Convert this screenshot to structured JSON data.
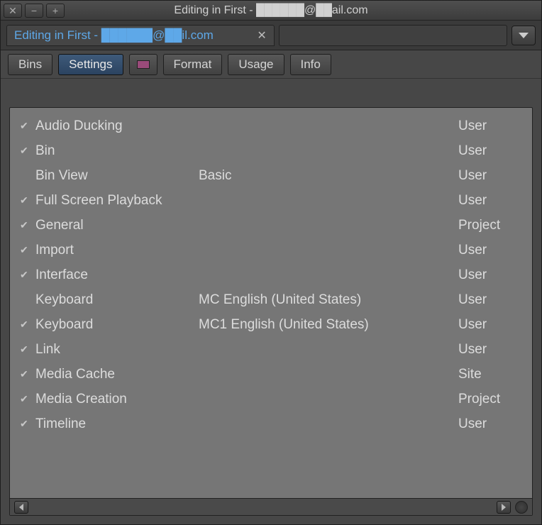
{
  "window": {
    "title": "Editing in First - ██████@██ail.com"
  },
  "doc_tab": {
    "label": "Editing in First - ██████@██il.com"
  },
  "toolbar": {
    "bins": "Bins",
    "settings": "Settings",
    "format": "Format",
    "usage": "Usage",
    "info": "Info"
  },
  "settings_rows": [
    {
      "checked": true,
      "name": "Audio Ducking",
      "detail": "",
      "scope": "User"
    },
    {
      "checked": true,
      "name": "Bin",
      "detail": "",
      "scope": "User"
    },
    {
      "checked": false,
      "name": "Bin View",
      "detail": "Basic",
      "scope": "User"
    },
    {
      "checked": true,
      "name": "Full Screen Playback",
      "detail": "",
      "scope": "User"
    },
    {
      "checked": true,
      "name": "General",
      "detail": "",
      "scope": "Project"
    },
    {
      "checked": true,
      "name": "Import",
      "detail": "",
      "scope": "User"
    },
    {
      "checked": true,
      "name": "Interface",
      "detail": "",
      "scope": "User"
    },
    {
      "checked": false,
      "name": "Keyboard",
      "detail": "MC English (United States)",
      "scope": "User"
    },
    {
      "checked": true,
      "name": "Keyboard",
      "detail": "MC1 English (United States)",
      "scope": "User"
    },
    {
      "checked": true,
      "name": "Link",
      "detail": "",
      "scope": "User"
    },
    {
      "checked": true,
      "name": "Media Cache",
      "detail": "",
      "scope": "Site"
    },
    {
      "checked": true,
      "name": "Media Creation",
      "detail": "",
      "scope": "Project"
    },
    {
      "checked": true,
      "name": "Timeline",
      "detail": "",
      "scope": "User"
    }
  ]
}
